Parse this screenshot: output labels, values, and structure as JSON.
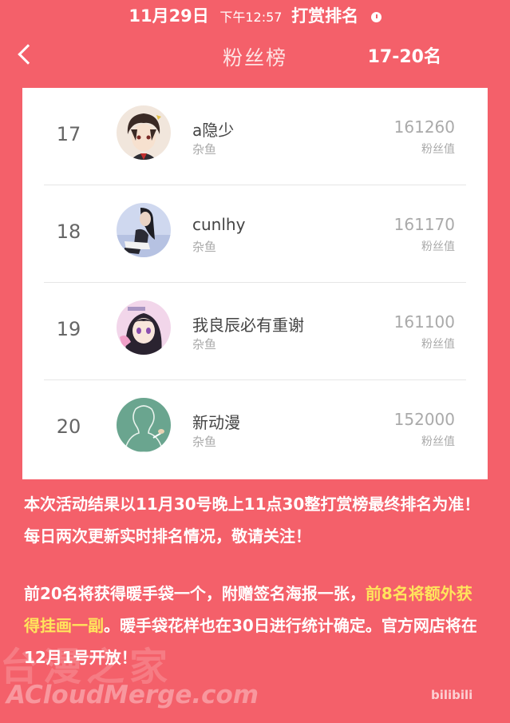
{
  "status_bar": {
    "date": "11月29日",
    "time": "下午12:57",
    "title": "打赏排名",
    "clock_icon": "clock-icon"
  },
  "nav": {
    "back_icon": "chevron-left-icon",
    "title": "粉丝榜",
    "range": "17-20名"
  },
  "ranking": [
    {
      "rank": "17",
      "name": "a隐少",
      "tag": "杂鱼",
      "score": "161260",
      "score_label": "粉丝值",
      "avatar": "anime-boy-avatar"
    },
    {
      "rank": "18",
      "name": "cunlhy",
      "tag": "杂鱼",
      "score": "161170",
      "score_label": "粉丝值",
      "avatar": "girl-sitting-avatar"
    },
    {
      "rank": "19",
      "name": "我良辰必有重谢",
      "tag": "杂鱼",
      "score": "161100",
      "score_label": "粉丝值",
      "avatar": "anime-girl-avatar"
    },
    {
      "rank": "20",
      "name": "新动漫",
      "tag": "杂鱼",
      "score": "152000",
      "score_label": "粉丝值",
      "avatar": "default-sketch-avatar"
    }
  ],
  "notice": {
    "para1": "本次活动结果以11月30号晚上11点30整打赏榜最终排名为准！每日两次更新实时排名情况，敬请关注！",
    "para2_a": "前20名将获得暖手袋一个，附赠签名海报一张，",
    "para2_highlight": "前8名将额外获得挂画一副",
    "para2_b": "。暖手袋花样也在30日进行统计确定。官方网店将在12月1号开放！"
  },
  "watermark": {
    "text": "ACloudMerge.com",
    "bg_text": "台漫之家",
    "corner_logo": "bilibili"
  },
  "colors": {
    "background": "#f4606a",
    "card": "#ffffff",
    "highlight": "#ffe45c"
  }
}
